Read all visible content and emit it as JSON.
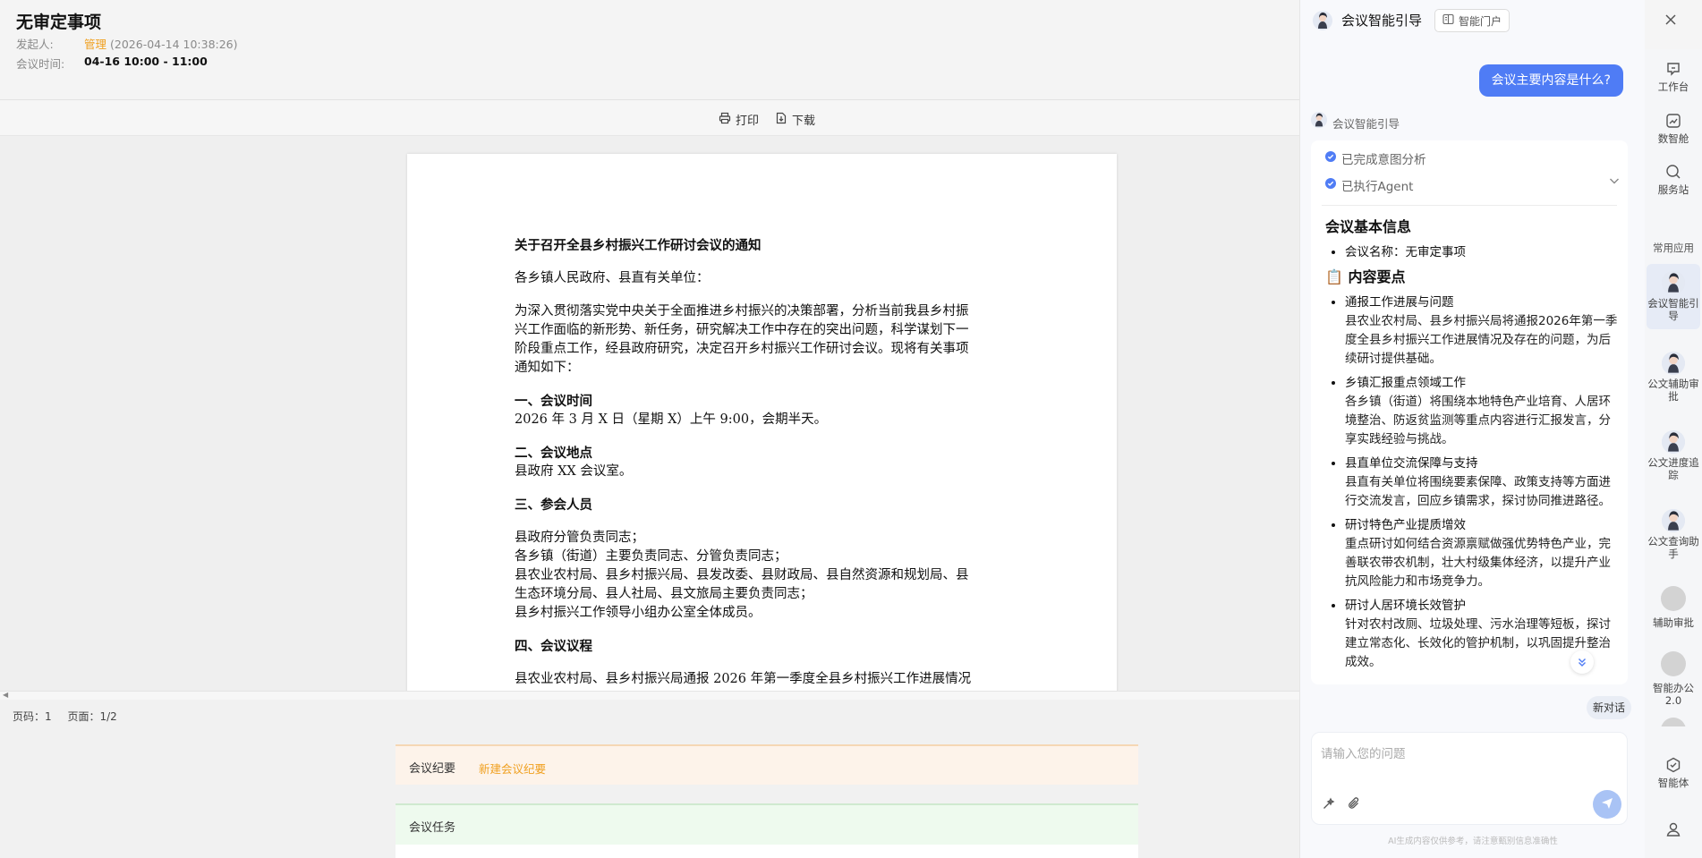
{
  "meeting": {
    "title": "无审定事项",
    "initiator_label": "发起人:",
    "initiator_name": "管理",
    "initiator_time": "(2026-04-14 10:38:26)",
    "time_label": "会议时间:",
    "time_value": "04-16 10:00 - 11:00"
  },
  "toolbar": {
    "print_label": "打印",
    "download_label": "下载"
  },
  "document": {
    "title": "关于召开全县乡村振兴工作研讨会议的通知",
    "salutation": "各乡镇人民政府、县直有关单位：",
    "intro_lines": [
      "为深入贯彻落实党中央关于全面推进乡村振兴的决策部署，分析当前我县乡村振",
      "兴工作面临的新形势、新任务，研究解决工作中存在的突出问题，科学谋划下一",
      "阶段重点工作，经县政府研究，决定召开乡村振兴工作研讨会议。现将有关事项",
      "通知如下："
    ],
    "section1_title": "一、会议时间",
    "section1_body": "2026 年 3 月 X 日（星期 X）上午 9:00，会期半天。",
    "section2_title": "二、会议地点",
    "section2_body": "县政府 XX 会议室。",
    "section3_title": "三、参会人员",
    "section3_lines": [
      "县政府分管负责同志；",
      "各乡镇（街道）主要负责同志、分管负责同志；",
      "县农业农村局、县乡村振兴局、县发改委、县财政局、县自然资源和规划局、县",
      "生态环境分局、县人社局、县文旅局主要负责同志；",
      "县乡村振兴工作领导小组办公室全体成员。"
    ],
    "section4_title": "四、会议议程",
    "section4_line": "县农业农村局、县乡村振兴局通报 2026 年第一季度全县乡村振兴工作进展情况"
  },
  "page_info": {
    "page_no": "页码：1",
    "pages": "页面：1/2"
  },
  "minutes": {
    "title": "会议纪要",
    "action": "新建会议纪要"
  },
  "tasks": {
    "title": "会议任务"
  },
  "assistant": {
    "title": "会议智能引导",
    "portal_label": "智能门户",
    "user_question": "会议主要内容是什么?",
    "bot_name": "会议智能引导",
    "status_intent": "已完成意图分析",
    "status_agent": "已执行Agent",
    "basic_info_heading": "会议基本信息",
    "basic_info_items": [
      "会议名称：无审定事项"
    ],
    "key_points_heading": "内容要点",
    "key_points": [
      {
        "title": "通报工作进展与问题",
        "desc": "县农业农村局、县乡村振兴局将通报2026年第一季度全县乡村振兴工作进展情况及存在的问题，为后续研讨提供基础。"
      },
      {
        "title": "乡镇汇报重点领域工作",
        "desc": "各乡镇（街道）将围绕本地特色产业培育、人居环境整治、防返贫监测等重点内容进行汇报发言，分享实践经验与挑战。"
      },
      {
        "title": "县直单位交流保障与支持",
        "desc": "县直有关单位将围绕要素保障、政策支持等方面进行交流发言，回应乡镇需求，探讨协同推进路径。"
      },
      {
        "title": "研讨特色产业提质增效",
        "desc": "重点研讨如何结合资源禀赋做强优势特色产业，完善联农带农机制，壮大村级集体经济，以提升产业抗风险能力和市场竞争力。"
      },
      {
        "title": "研讨人居环境长效管护",
        "desc": "针对农村改厕、垃圾处理、污水治理等短板，探讨建立常态化、长效化的管护机制，以巩固提升整治成效。"
      }
    ],
    "new_chat_label": "新对话",
    "input_placeholder": "请输入您的问题",
    "disclaimer": "AI生成内容仅供参考，请注意甄别信息准确性"
  },
  "rail": {
    "items_top": [
      {
        "label": "工作台",
        "icon": "workbench-icon"
      },
      {
        "label": "数智舱",
        "icon": "data-cabin-icon"
      },
      {
        "label": "服务站",
        "icon": "service-station-icon"
      }
    ],
    "section_label": "常用应用",
    "apps": [
      {
        "label": "会议智能引导"
      },
      {
        "label": "公文辅助审批"
      },
      {
        "label": "公文进度追踪"
      },
      {
        "label": "公文查询助手"
      },
      {
        "label": "辅助审批"
      },
      {
        "label": "智能办公2.0"
      }
    ],
    "bottom_items": [
      {
        "label": "智能体",
        "icon": "agent-icon"
      }
    ]
  },
  "colors": {
    "accent_blue": "#4f7cf5",
    "link_orange": "#f0a020",
    "minutes_bg": "#fdf3ea",
    "tasks_bg": "#eefaee"
  }
}
